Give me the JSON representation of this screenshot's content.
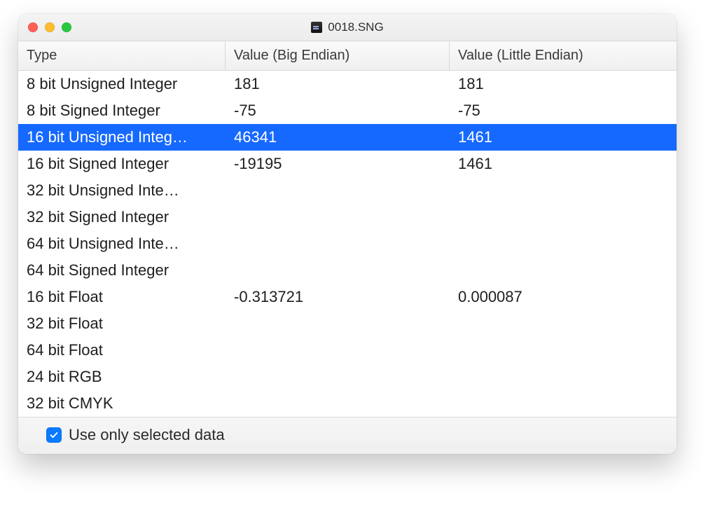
{
  "window": {
    "title": "0018.SNG"
  },
  "table": {
    "columns": [
      "Type",
      "Value (Big Endian)",
      "Value (Little Endian)"
    ],
    "selected_index": 2,
    "rows": [
      {
        "type": "8 bit Unsigned Integer",
        "big": "181",
        "little": "181"
      },
      {
        "type": "8 bit Signed Integer",
        "big": "-75",
        "little": "-75"
      },
      {
        "type": "16 bit Unsigned Integ…",
        "big": "46341",
        "little": "1461"
      },
      {
        "type": "16 bit Signed Integer",
        "big": "-19195",
        "little": "1461"
      },
      {
        "type": "32 bit Unsigned Inte…",
        "big": "",
        "little": ""
      },
      {
        "type": "32 bit Signed Integer",
        "big": "",
        "little": ""
      },
      {
        "type": "64 bit Unsigned Inte…",
        "big": "",
        "little": ""
      },
      {
        "type": "64 bit Signed Integer",
        "big": "",
        "little": ""
      },
      {
        "type": "16 bit Float",
        "big": "-0.313721",
        "little": "0.000087"
      },
      {
        "type": "32 bit Float",
        "big": "",
        "little": ""
      },
      {
        "type": "64 bit Float",
        "big": "",
        "little": ""
      },
      {
        "type": "24 bit RGB",
        "big": "",
        "little": ""
      },
      {
        "type": "32 bit CMYK",
        "big": "",
        "little": ""
      }
    ]
  },
  "footer": {
    "checkbox_label": "Use only selected data",
    "checkbox_checked": true
  }
}
